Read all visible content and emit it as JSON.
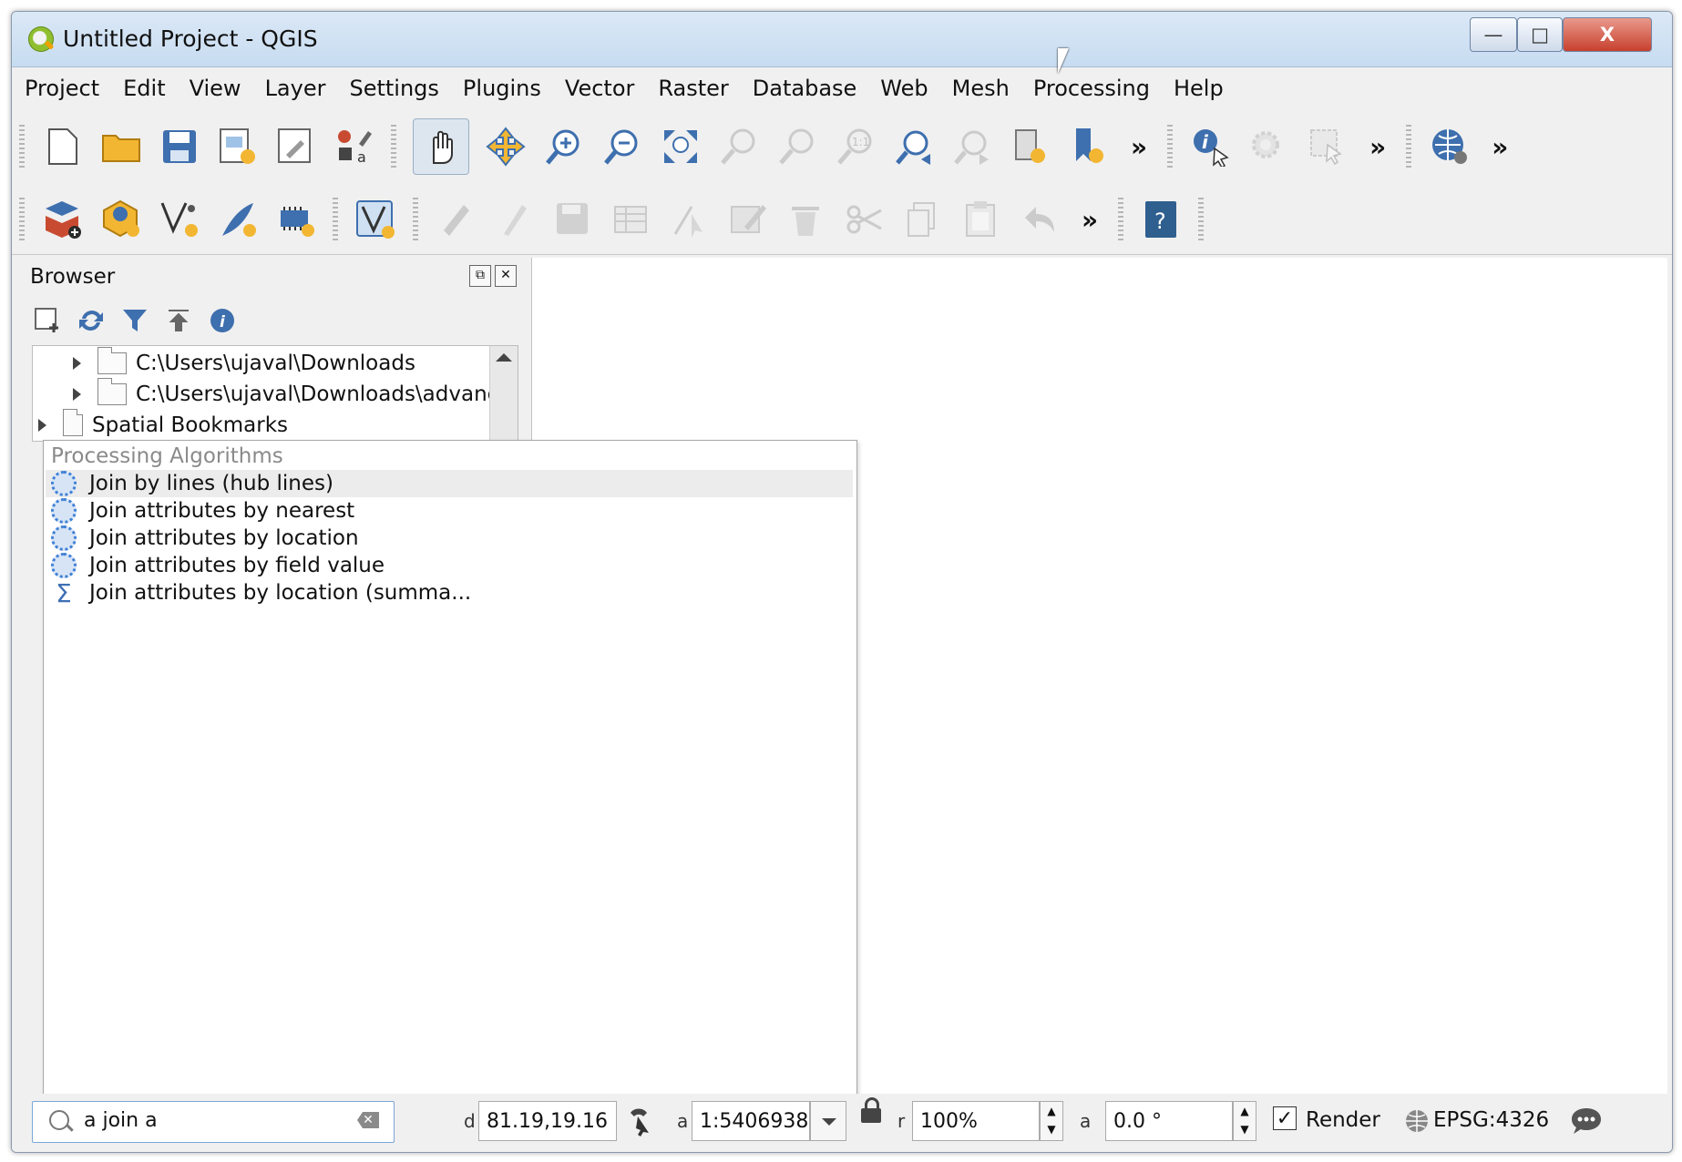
{
  "window": {
    "title": "Untitled Project - QGIS"
  },
  "menu": {
    "items": [
      {
        "label": "Project"
      },
      {
        "label": "Edit"
      },
      {
        "label": "View"
      },
      {
        "label": "Layer"
      },
      {
        "label": "Settings"
      },
      {
        "label": "Plugins"
      },
      {
        "label": "Vector"
      },
      {
        "label": "Raster"
      },
      {
        "label": "Database"
      },
      {
        "label": "Web"
      },
      {
        "label": "Mesh"
      },
      {
        "label": "Processing"
      },
      {
        "label": "Help"
      }
    ]
  },
  "toolbar": {
    "overflow": "»"
  },
  "browser": {
    "title": "Browser",
    "tree": {
      "downloads": "C:\\Users\\ujaval\\Downloads",
      "downloads_advanced": "C:\\Users\\ujaval\\Downloads\\advanc",
      "spatial_bookmarks": "Spatial Bookmarks"
    }
  },
  "locator": {
    "group_header": "Processing Algorithms",
    "results": [
      {
        "label": "Join by lines (hub lines)"
      },
      {
        "label": "Join attributes by nearest"
      },
      {
        "label": "Join attributes by location"
      },
      {
        "label": "Join attributes by field value"
      },
      {
        "label": "Join attributes by location (summa..."
      }
    ],
    "search_value": "a join a"
  },
  "status": {
    "coordinate_label": "d",
    "coordinate": "81.19,19.16",
    "scale_label": "a",
    "scale": "1:5406938",
    "magnifier_label": "r",
    "magnifier": "100%",
    "rotation_label": "a",
    "rotation": "0.0 °",
    "render_label": "Render",
    "render_checked": "✓",
    "crs": "EPSG:4326"
  }
}
